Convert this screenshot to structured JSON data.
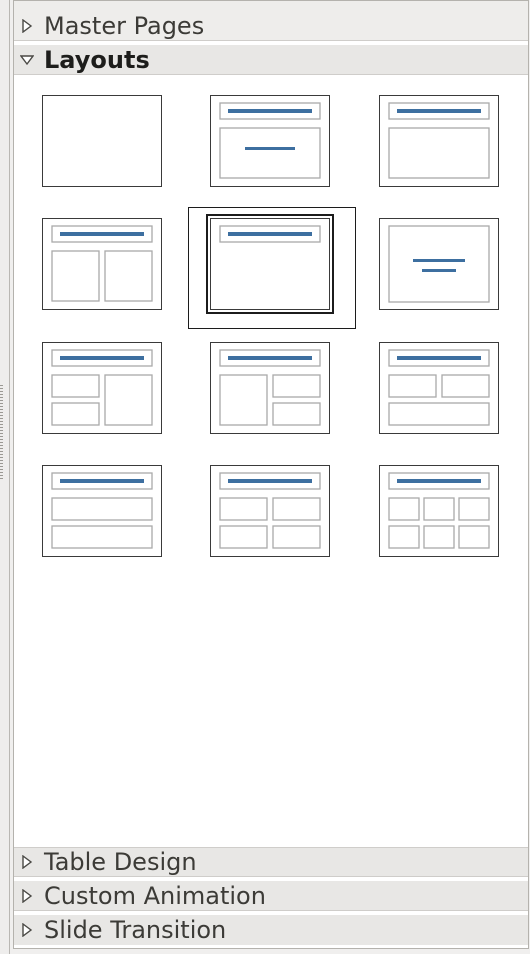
{
  "sidebar": {
    "sections": {
      "master_pages": {
        "label": "Master Pages",
        "expanded": false,
        "icon": "triangle-right-icon"
      },
      "layouts": {
        "label": "Layouts",
        "expanded": true,
        "icon": "triangle-down-icon"
      },
      "table_design": {
        "label": "Table Design",
        "expanded": false,
        "icon": "triangle-right-icon"
      },
      "custom_animation": {
        "label": "Custom Animation",
        "expanded": false,
        "icon": "triangle-right-icon"
      },
      "slide_transition": {
        "label": "Slide Transition",
        "expanded": false,
        "icon": "triangle-right-icon"
      }
    },
    "layouts": {
      "items": [
        {
          "name": "blank-slide",
          "selected": false
        },
        {
          "name": "title-slide",
          "selected": false
        },
        {
          "name": "title-content",
          "selected": false
        },
        {
          "name": "title-2-content",
          "selected": false
        },
        {
          "name": "title-only",
          "selected": true
        },
        {
          "name": "centered-text",
          "selected": false
        },
        {
          "name": "title-2-content-and-content",
          "selected": false
        },
        {
          "name": "title-content-and-2-content",
          "selected": false
        },
        {
          "name": "title-2-content-over-content",
          "selected": false
        },
        {
          "name": "title-content-over-content",
          "selected": false
        },
        {
          "name": "title-4-content",
          "selected": false
        },
        {
          "name": "title-6-content",
          "selected": false
        }
      ]
    },
    "colors": {
      "accent_line": "#3d6fa0",
      "placeholder_border": "#a9a9a9",
      "thumb_border": "#3a3a3a"
    }
  }
}
